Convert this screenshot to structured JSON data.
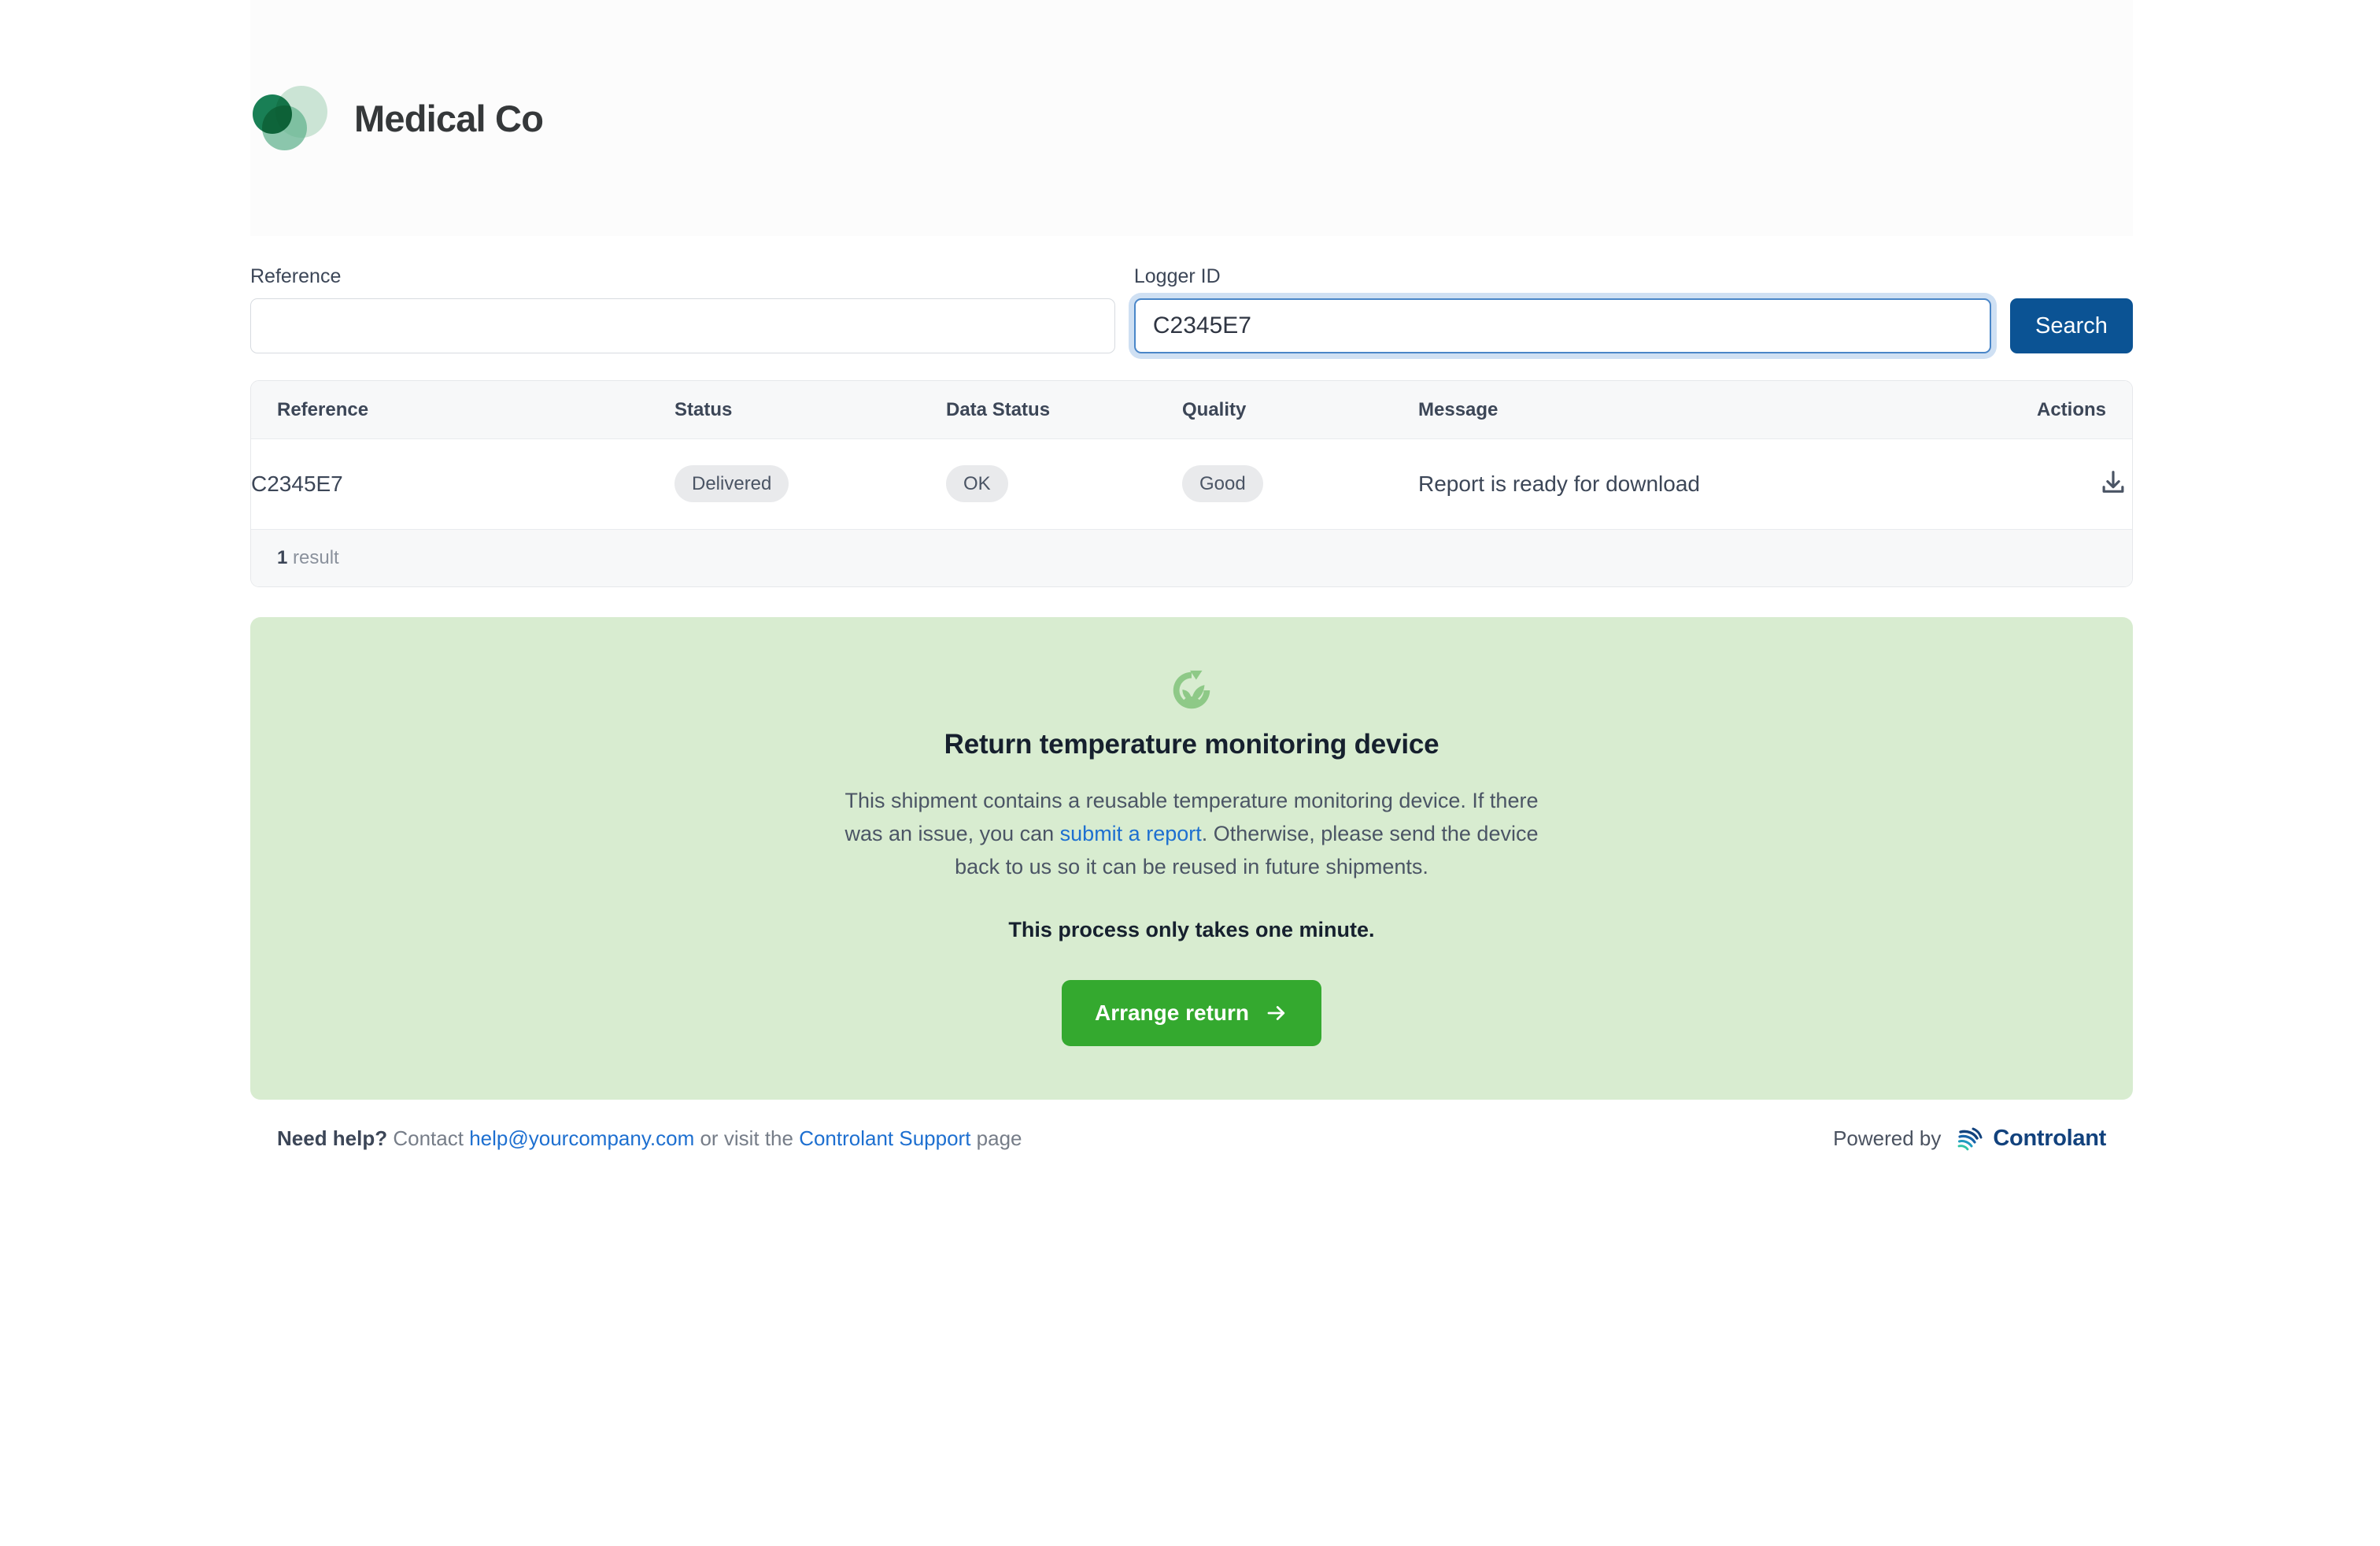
{
  "brand": {
    "name": "Medical Co",
    "logo_icon": "three-circles-logo",
    "colors": {
      "dark_green": "#0c7a4d",
      "mid_green": "#5fb28d",
      "light_green": "#89c4a0"
    }
  },
  "search": {
    "reference_label": "Reference",
    "reference_value": "",
    "reference_placeholder": "",
    "logger_label": "Logger ID",
    "logger_value": "C2345E7",
    "logger_placeholder": "",
    "search_button": "Search",
    "search_button_color": "#0b5394",
    "focused_field": "logger-id"
  },
  "table": {
    "headers": {
      "reference": "Reference",
      "status": "Status",
      "data_status": "Data Status",
      "quality": "Quality",
      "message": "Message",
      "actions": "Actions"
    },
    "rows": [
      {
        "reference": "C2345E7",
        "status": "Delivered",
        "data_status": "OK",
        "quality": "Good",
        "message": "Report is ready for download",
        "action_icon": "download-icon"
      }
    ],
    "footer_count": "1",
    "footer_label": "result"
  },
  "return_panel": {
    "icon": "recycle-sprout-icon",
    "title": "Return temperature monitoring device",
    "body_part1": "This shipment contains a reusable temperature monitoring device. If there was an issue, you can ",
    "body_link": "submit a report",
    "body_part2": ". Otherwise, please send the device back to us so it can be reused in future shipments.",
    "note": "This process only takes one minute.",
    "cta_label": "Arrange return",
    "cta_icon": "arrow-right-icon",
    "cta_color": "#34a92f",
    "background_color": "#d8ecd0"
  },
  "footer": {
    "need_help": "Need help?",
    "contact_prefix": " Contact ",
    "email": "help@yourcompany.com",
    "middle": " or visit the ",
    "support_link": "Controlant Support",
    "suffix": " page",
    "powered_by": "Powered by",
    "powered_brand": "Controlant",
    "powered_icon": "controlant-signal-logo"
  }
}
